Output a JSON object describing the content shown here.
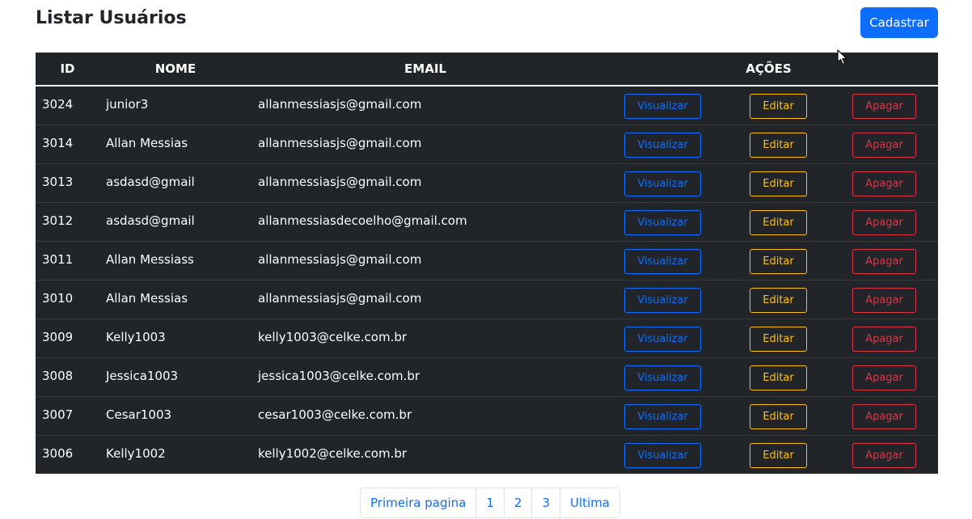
{
  "page_title": "Listar Usuários",
  "create_button_label": "Cadastrar",
  "table": {
    "headers": {
      "id": "ID",
      "nome": "NOME",
      "email": "EMAIL",
      "acoes": "AÇÕES"
    },
    "action_labels": {
      "view": "Visualizar",
      "edit": "Editar",
      "delete": "Apagar"
    },
    "rows": [
      {
        "id": "3024",
        "nome": "junior3",
        "email": "allanmessiasjs@gmail.com"
      },
      {
        "id": "3014",
        "nome": "Allan Messias",
        "email": "allanmessiasjs@gmail.com"
      },
      {
        "id": "3013",
        "nome": "asdasd@gmail",
        "email": "allanmessiasjs@gmail.com"
      },
      {
        "id": "3012",
        "nome": "asdasd@gmail",
        "email": "allanmessiasdecoelho@gmail.com"
      },
      {
        "id": "3011",
        "nome": "Allan Messiass",
        "email": "allanmessiasjs@gmail.com"
      },
      {
        "id": "3010",
        "nome": "Allan Messias",
        "email": "allanmessiasjs@gmail.com"
      },
      {
        "id": "3009",
        "nome": "Kelly1003",
        "email": "kelly1003@celke.com.br"
      },
      {
        "id": "3008",
        "nome": "Jessica1003",
        "email": "jessica1003@celke.com.br"
      },
      {
        "id": "3007",
        "nome": "Cesar1003",
        "email": "cesar1003@celke.com.br"
      },
      {
        "id": "3006",
        "nome": "Kelly1002",
        "email": "kelly1002@celke.com.br"
      }
    ]
  },
  "pagination": {
    "first_label": "Primeira pagina",
    "pages": [
      "1",
      "2",
      "3"
    ],
    "last_label": "Ultima"
  },
  "colors": {
    "primary": "#0d6efd",
    "warning": "#ffc107",
    "danger": "#dc3545",
    "table_dark": "#212529"
  },
  "icons": {
    "cursor": "mouse-pointer-icon"
  }
}
